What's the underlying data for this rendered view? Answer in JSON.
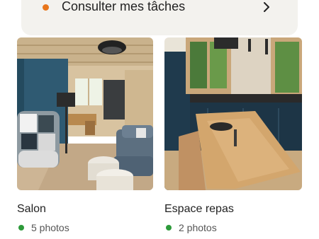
{
  "task": {
    "label": "Consulter mes tâches",
    "status_color": "#e8751a",
    "icon": "chevron-right-icon"
  },
  "rooms": [
    {
      "title": "Salon",
      "photos_label": "5 photos",
      "status_color": "#2d9a3a"
    },
    {
      "title": "Espace repas",
      "photos_label": "2 photos",
      "status_color": "#2d9a3a"
    }
  ]
}
